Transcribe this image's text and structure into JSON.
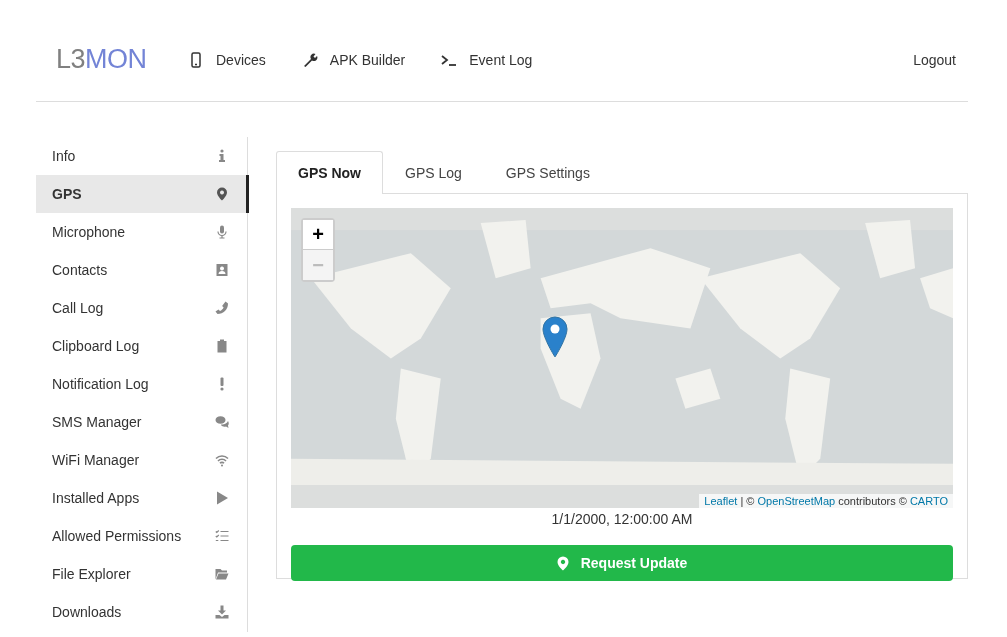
{
  "logo": {
    "parts": [
      {
        "text": "L3",
        "color": "#808080"
      },
      {
        "text": "MON",
        "color": "#7384d6"
      }
    ]
  },
  "nav": [
    {
      "label": "Devices",
      "kind": "phone"
    },
    {
      "label": "APK Builder",
      "kind": "wrench"
    },
    {
      "label": "Event Log",
      "kind": "terminal"
    }
  ],
  "logout": "Logout",
  "sidebar": {
    "items": [
      {
        "label": "Info",
        "kind": "info",
        "selected": false
      },
      {
        "label": "GPS",
        "kind": "pin",
        "selected": true
      },
      {
        "label": "Microphone",
        "kind": "mic",
        "selected": false
      },
      {
        "label": "Contacts",
        "kind": "contact",
        "selected": false
      },
      {
        "label": "Call Log",
        "kind": "phone",
        "selected": false
      },
      {
        "label": "Clipboard Log",
        "kind": "clipboard",
        "selected": false
      },
      {
        "label": "Notification Log",
        "kind": "exclaim",
        "selected": false
      },
      {
        "label": "SMS Manager",
        "kind": "chat",
        "selected": false
      },
      {
        "label": "WiFi Manager",
        "kind": "wifi",
        "selected": false
      },
      {
        "label": "Installed Apps",
        "kind": "play",
        "selected": false
      },
      {
        "label": "Allowed Permissions",
        "kind": "list",
        "selected": false
      },
      {
        "label": "File Explorer",
        "kind": "folder",
        "selected": false
      },
      {
        "label": "Downloads",
        "kind": "download",
        "selected": false
      }
    ]
  },
  "tabs": [
    {
      "label": "GPS Now",
      "selected": true
    },
    {
      "label": "GPS Log",
      "selected": false
    },
    {
      "label": "GPS Settings",
      "selected": false
    }
  ],
  "map": {
    "zoom_in": "+",
    "zoom_out": "−",
    "zoom_out_disabled": true,
    "attribution": [
      {
        "text": "Leaflet",
        "link": true
      },
      {
        "text": " | © ",
        "link": false
      },
      {
        "text": "OpenStreetMap",
        "link": true
      },
      {
        "text": " contributors © ",
        "link": false
      },
      {
        "text": "CARTO",
        "link": true
      }
    ]
  },
  "timestamp": "1/1/2000, 12:00:00 AM",
  "request_button": "Request Update"
}
